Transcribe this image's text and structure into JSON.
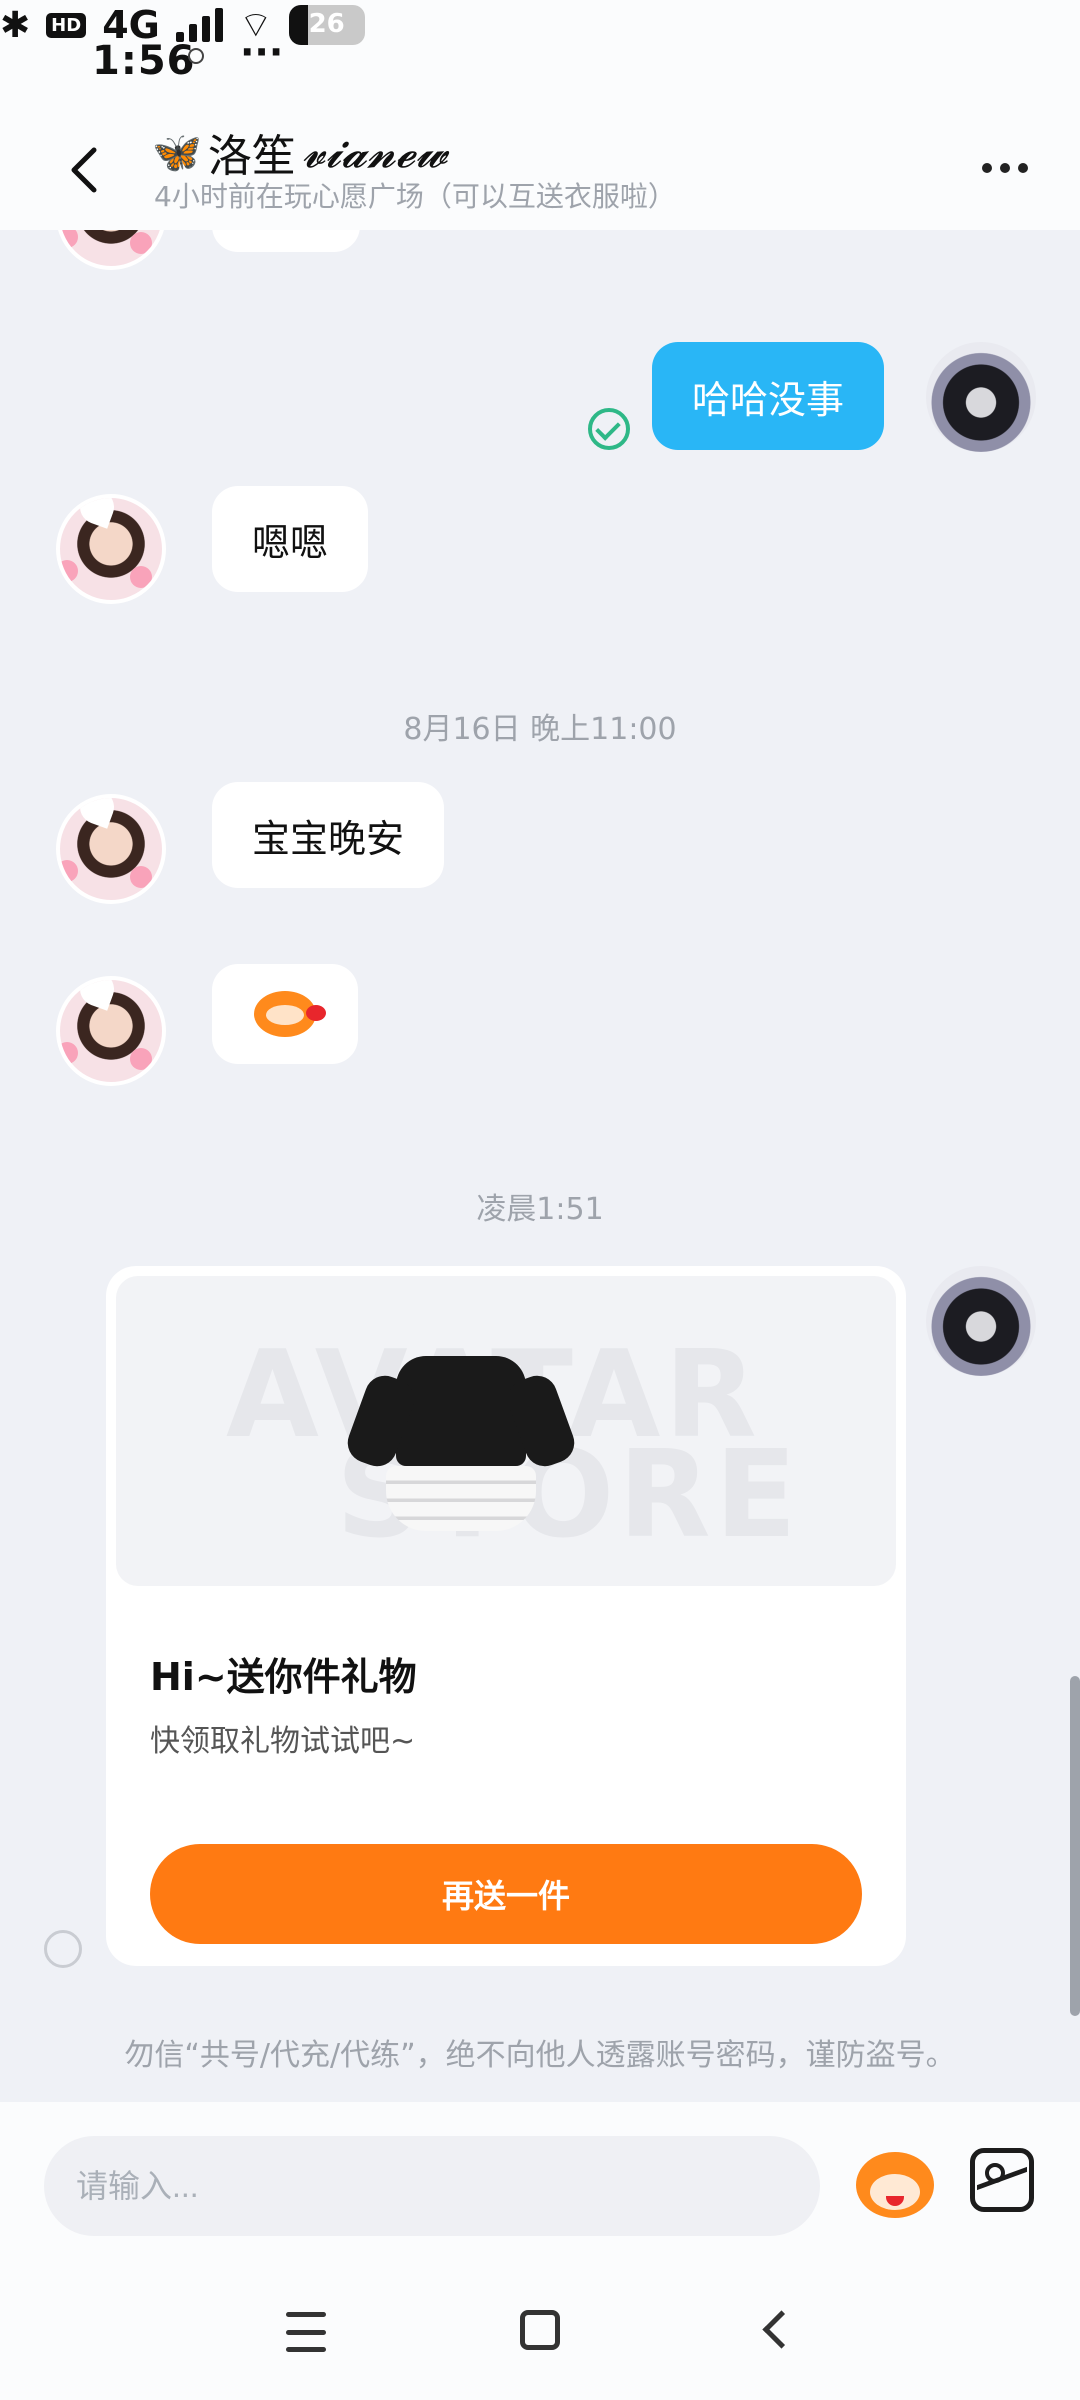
{
  "status_bar": {
    "time": "1:56",
    "network_badge": "HD",
    "network": "4G",
    "battery": "26"
  },
  "header": {
    "name": "洛笙",
    "name_script": "𝓿𝓲𝓪𝓷𝓮𝔀",
    "butterfly": "🦋",
    "subtitle": "4小时前在玩心愿广场（可以互送衣服啦）"
  },
  "messages": [
    {
      "side": "right",
      "text": "哈哈没事"
    },
    {
      "side": "left",
      "text": "嗯嗯"
    },
    {
      "side": "left",
      "text": "宝宝晚安"
    }
  ],
  "timestamps": [
    "8月16日 晚上11:00",
    "凌晨1:51"
  ],
  "gift": {
    "watermark_1": "AVATAR",
    "watermark_2": "STORE",
    "title": "Hi~送你件礼物",
    "subtitle": "快领取礼物试试吧~",
    "button": "再送一件"
  },
  "warning": "勿信“共号/代充/代练”，绝不向他人透露账号密码，谨防盗号。",
  "input": {
    "placeholder": "请输入..."
  }
}
